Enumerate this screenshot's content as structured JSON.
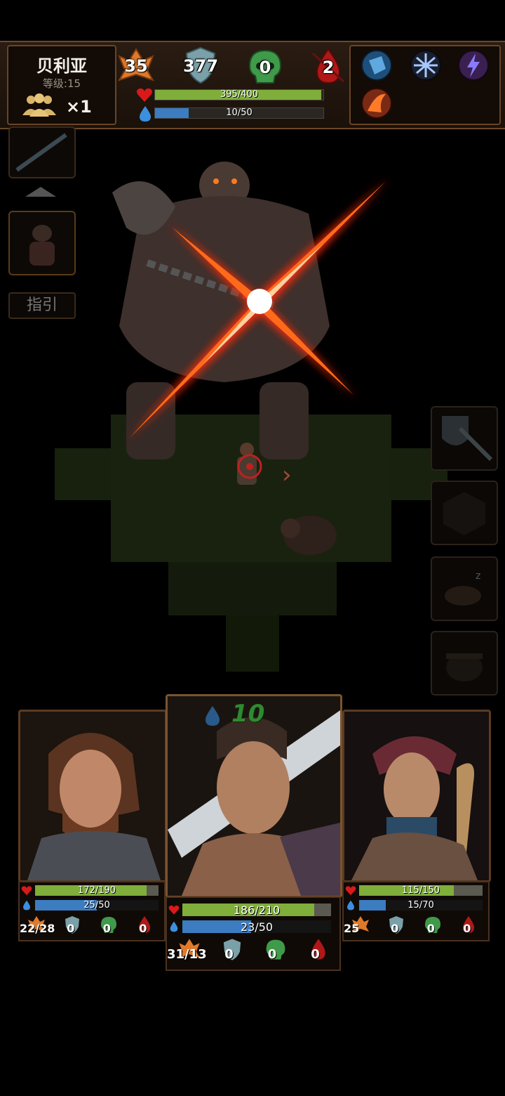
{
  "hero": {
    "name": "贝利亚",
    "level": "等级:15",
    "party_count": "×1"
  },
  "stats": {
    "attack": "35",
    "armor": "377",
    "poison": "0",
    "bleed": "2"
  },
  "hp": {
    "text": "395/400",
    "fraction": 0.9875
  },
  "mp": {
    "text": "10/50",
    "fraction": 0.2
  },
  "skills": [
    "ice-orb-skill-icon",
    "frost-web-skill-icon",
    "lightning-skill-icon",
    "fire-slash-skill-icon"
  ],
  "guide_label": "指引",
  "floating_mana": "10",
  "party": [
    {
      "hp": "172/190",
      "hp_frac": 0.905,
      "mp": "25/50",
      "mp_frac": 0.5,
      "attack": "22/28",
      "armor": "0",
      "poison": "0",
      "bleed": "0"
    },
    {
      "hp": "186/210",
      "hp_frac": 0.886,
      "mp": "23/50",
      "mp_frac": 0.46,
      "attack": "31/13",
      "armor": "0",
      "poison": "0",
      "bleed": "0"
    },
    {
      "hp": "115/150",
      "hp_frac": 0.767,
      "mp": "15/70",
      "mp_frac": 0.214,
      "attack": "25",
      "armor": "0",
      "poison": "0",
      "bleed": "0"
    }
  ],
  "colors": {
    "hp": "#7fae3a",
    "mp": "#3c7cc0",
    "frame": "#6a4526",
    "slash": "#ff4a10"
  }
}
